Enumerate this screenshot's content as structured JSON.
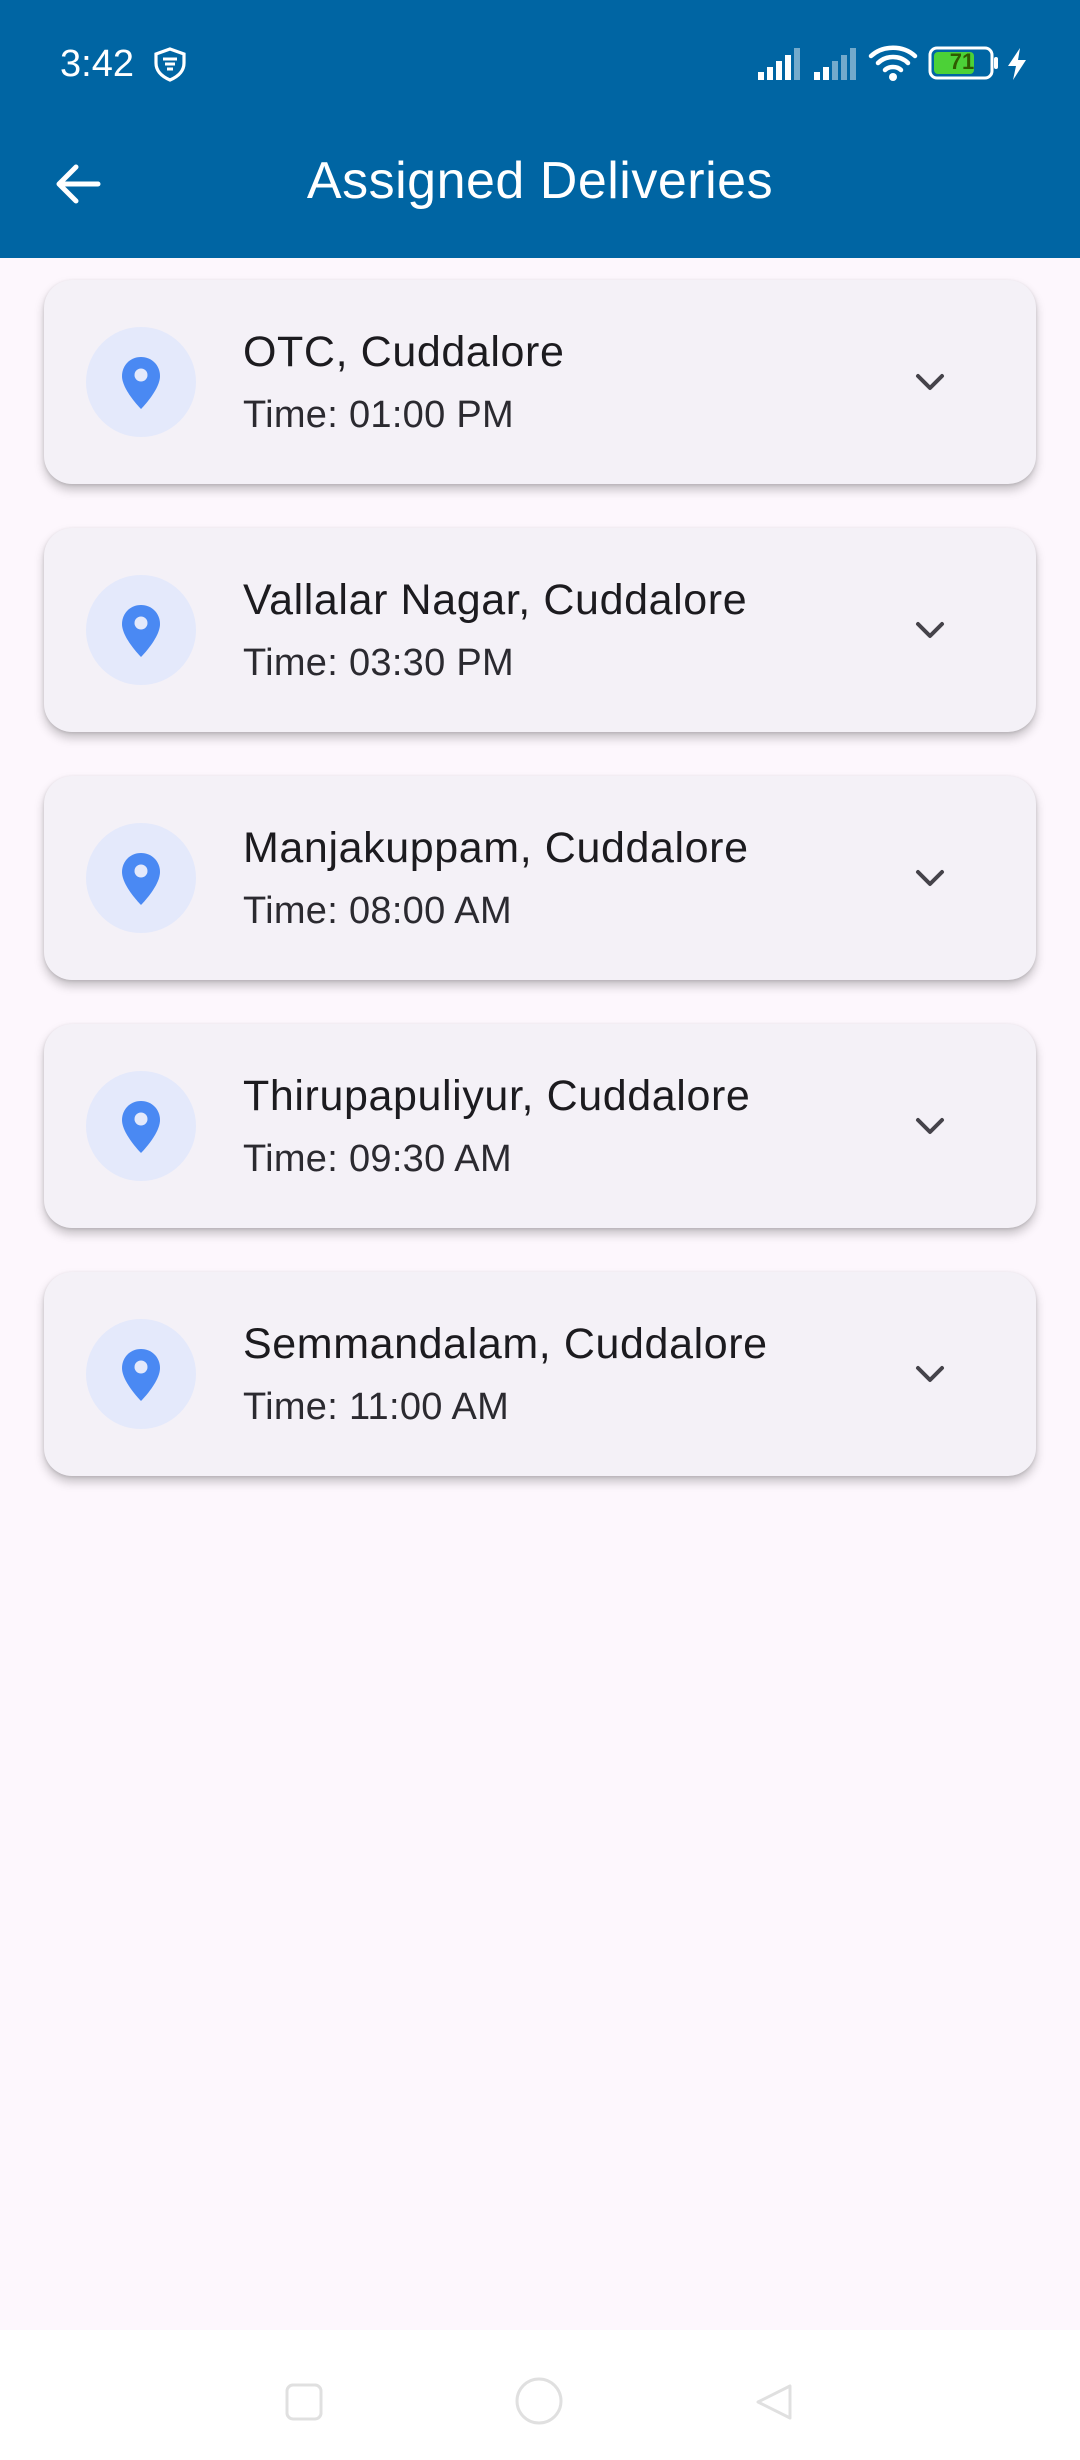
{
  "status_bar": {
    "time": "3:42",
    "battery_level": "71"
  },
  "app_bar": {
    "title": "Assigned Deliveries"
  },
  "deliveries": [
    {
      "location": "OTC, Cuddalore",
      "time": "Time: 01:00 PM"
    },
    {
      "location": "Vallalar Nagar, Cuddalore",
      "time": "Time: 03:30 PM"
    },
    {
      "location": "Manjakuppam, Cuddalore",
      "time": "Time: 08:00 AM"
    },
    {
      "location": "Thirupapuliyur, Cuddalore",
      "time": "Time: 09:30 AM"
    },
    {
      "location": "Semmandalam, Cuddalore",
      "time": "Time: 11:00 AM"
    }
  ],
  "icons": {
    "back": "arrow-left-icon",
    "location": "location-pin-icon",
    "expand": "chevron-down-icon",
    "vpn": "vpn-shield-icon"
  },
  "colors": {
    "app_bar": "#0065a3",
    "background": "#fdf7fd",
    "card": "#f4f1f7",
    "pin": "#4a89f3",
    "pin_circle": "#e4e9fb",
    "battery": "#4cd137"
  }
}
